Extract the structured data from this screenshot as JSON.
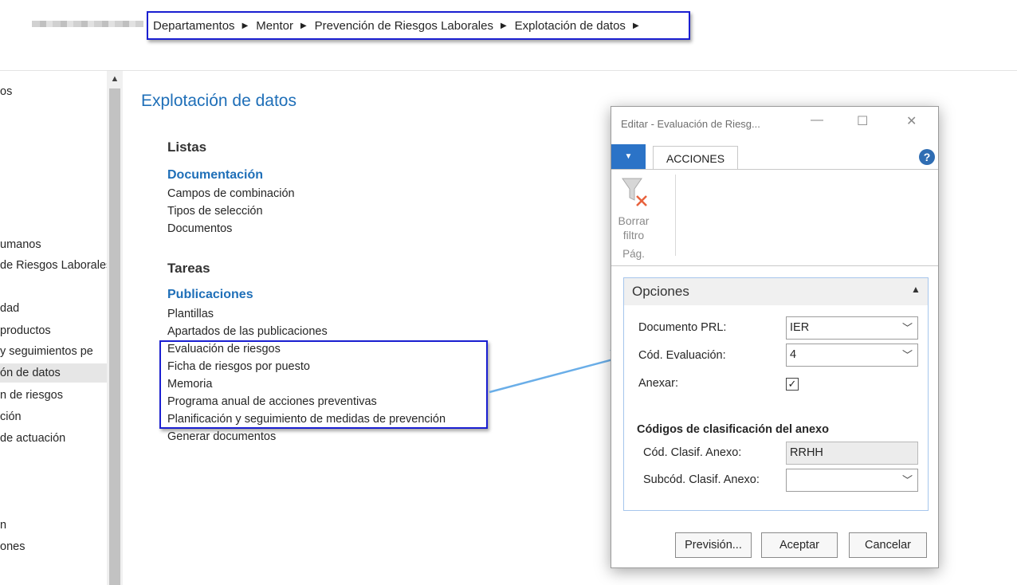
{
  "breadcrumb": {
    "items": [
      "Departamentos",
      "Mentor",
      "Prevención de Riesgos Laborales",
      "Explotación de datos"
    ],
    "separator": "▶"
  },
  "nav": {
    "items": [
      {
        "label": "os",
        "selected": false
      },
      {
        "label": "umanos",
        "selected": false
      },
      {
        "label": "de Riesgos Laborales",
        "selected": false
      },
      {
        "label": "dad",
        "selected": false
      },
      {
        "label": "productos",
        "selected": false
      },
      {
        "label": "y seguimientos pe",
        "selected": false
      },
      {
        "label": "ón de datos",
        "selected": true
      },
      {
        "label": "n de riesgos",
        "selected": false
      },
      {
        "label": "ción",
        "selected": false
      },
      {
        "label": "de actuación",
        "selected": false
      },
      {
        "label": "n",
        "selected": false
      },
      {
        "label": "ones",
        "selected": false
      }
    ]
  },
  "main": {
    "title": "Explotación de datos",
    "listas": {
      "heading": "Listas",
      "group": "Documentación",
      "links": [
        "Campos de combinación",
        "Tipos de selección",
        "Documentos"
      ]
    },
    "tareas": {
      "heading": "Tareas",
      "group": "Publicaciones",
      "links": [
        "Plantillas",
        "Apartados de las publicaciones",
        "Evaluación de riesgos",
        "Ficha de riesgos por puesto",
        "Memoria",
        "Programa anual de acciones preventivas",
        "Planificación y seguimiento de medidas de prevención",
        "Generar documentos"
      ]
    }
  },
  "dialog": {
    "title": "Editar - Evaluación de Riesg...",
    "ribbon": {
      "tab": "ACCIONES",
      "clear_filter_label_1": "Borrar",
      "clear_filter_label_2": "filtro",
      "group_label": "Pág."
    },
    "options": {
      "title": "Opciones",
      "documento_prl_label": "Documento PRL:",
      "documento_prl_value": "IER",
      "cod_evaluacion_label": "Cód. Evaluación:",
      "cod_evaluacion_value": "4",
      "anexar_label": "Anexar:",
      "anexar_checked": true,
      "clasif_heading": "Códigos de clasificación del anexo",
      "cod_clasif_label": "Cód. Clasif. Anexo:",
      "cod_clasif_value": "RRHH",
      "subcod_clasif_label": "Subcód. Clasif. Anexo:",
      "subcod_clasif_value": ""
    },
    "buttons": {
      "preview": "Previsión...",
      "accept": "Aceptar",
      "cancel": "Cancelar"
    }
  },
  "colors": {
    "accent_blue": "#1f6fb8",
    "annotation_box": "#1a1fd1",
    "annotation_arrow": "#6aaee8",
    "ribbon_blue": "#2b73c7"
  }
}
